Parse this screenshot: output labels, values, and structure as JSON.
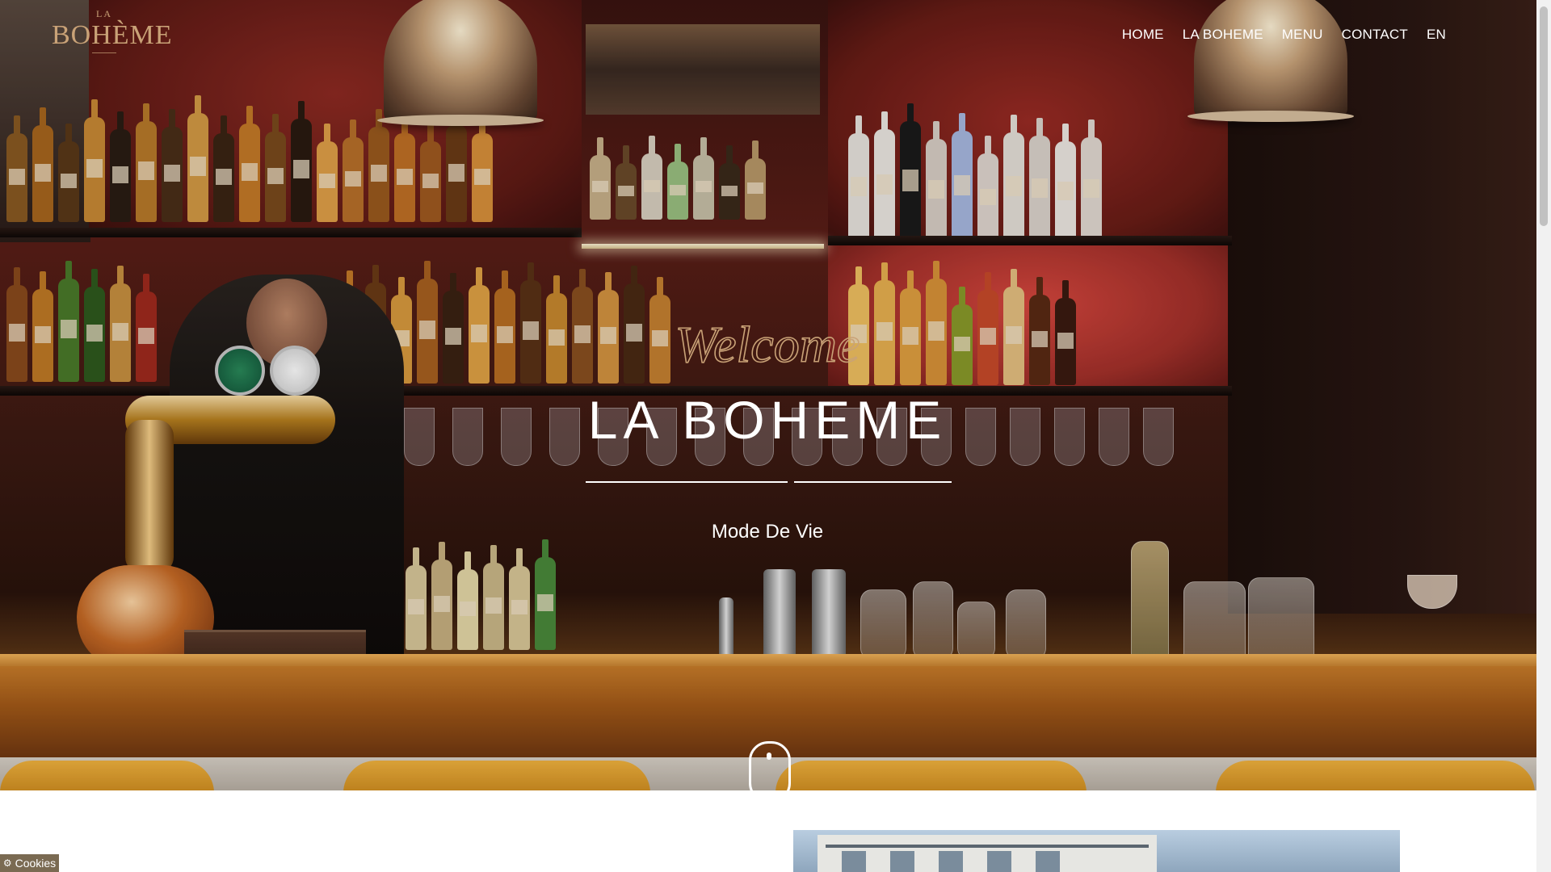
{
  "brand": {
    "logo_small": "LA",
    "logo_main": "BOHÈME"
  },
  "nav": {
    "items": [
      {
        "label": "HOME"
      },
      {
        "label": "LA BOHEME"
      },
      {
        "label": "MENU"
      },
      {
        "label": "CONTACT"
      },
      {
        "label": "EN"
      }
    ]
  },
  "hero": {
    "script_word": "Welcome",
    "title": "LA BOHEME",
    "subtitle": "Mode De Vie",
    "scroll_icon": "mouse-scroll-icon"
  },
  "cookies": {
    "label": "Cookies",
    "icon": "gear-icon"
  },
  "colors": {
    "accent_gold": "#c9a277",
    "cookie_bg": "#7a6a52"
  }
}
